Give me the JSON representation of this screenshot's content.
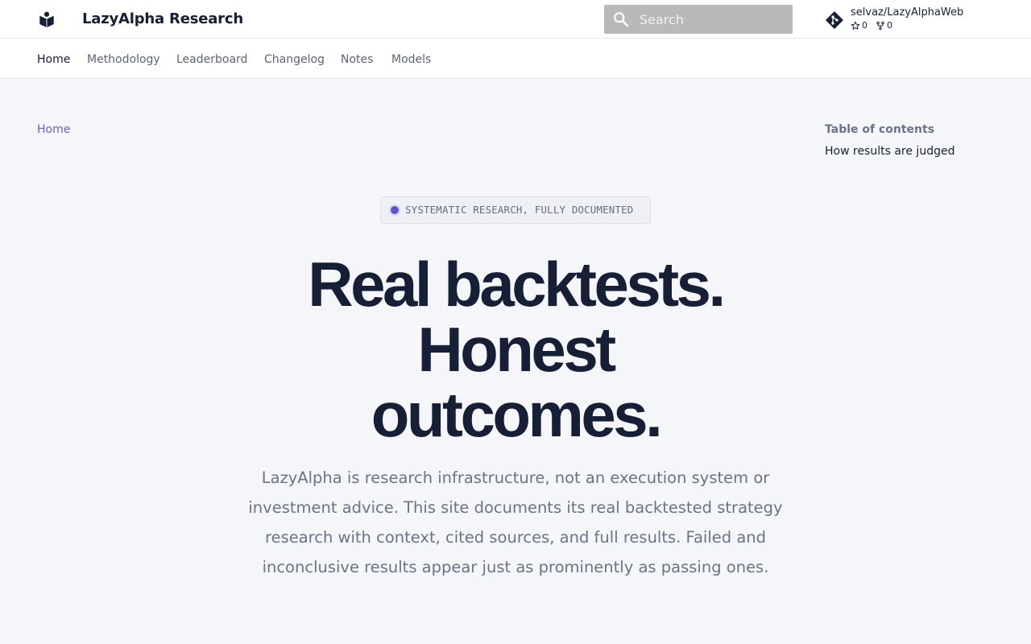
{
  "header": {
    "site_title": "LazyAlpha Research",
    "search_placeholder": "Search",
    "repo": {
      "name": "selvaz/LazyAlphaWeb",
      "stars": "0",
      "forks": "0"
    }
  },
  "tabs": [
    {
      "label": "Home",
      "active": true
    },
    {
      "label": "Methodology",
      "active": false
    },
    {
      "label": "Leaderboard",
      "active": false
    },
    {
      "label": "Changelog",
      "active": false
    },
    {
      "label": "Notes",
      "active": false
    },
    {
      "label": "Models",
      "active": false
    }
  ],
  "breadcrumb": "Home",
  "toc": {
    "title": "Table of contents",
    "items": [
      "How results are judged"
    ]
  },
  "hero": {
    "badge": "SYSTEMATIC RESEARCH, FULLY DOCUMENTED",
    "title_lines": [
      "Real backtests.",
      "Honest",
      "outcomes."
    ],
    "lead": "LazyAlpha is research infrastructure, not an execution system or investment advice. This site documents its real backtested strategy research with context, cited sources, and full results. Failed and inconclusive results appear just as prominently as passing ones."
  },
  "colors": {
    "accent": "#5f52d3",
    "link": "#6a5fc9",
    "text": "#161f36",
    "muted": "#6b7387",
    "page_bg": "#f4f6fa",
    "search_bg": "#b9b9b9"
  }
}
